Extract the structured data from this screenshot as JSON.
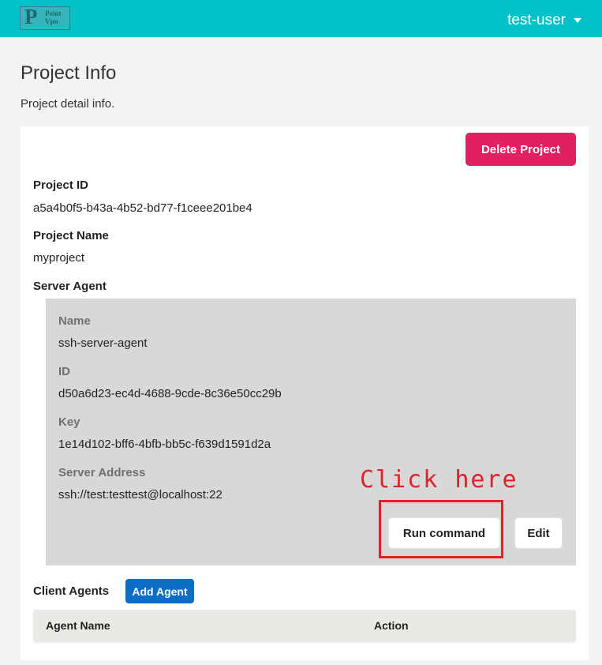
{
  "header": {
    "logo_letter": "P",
    "logo_text_line1": "Point",
    "logo_text_line2": "Vpn",
    "user_menu_label": "test-user"
  },
  "page": {
    "title": "Project Info",
    "subtitle": "Project detail info."
  },
  "actions": {
    "delete_project_label": "Delete Project"
  },
  "project": {
    "id_label": "Project ID",
    "id_value": "a5a4b0f5-b43a-4b52-bd77-f1ceee201be4",
    "name_label": "Project Name",
    "name_value": "myproject"
  },
  "server_agent": {
    "section_label": "Server Agent",
    "name_label": "Name",
    "name_value": "ssh-server-agent",
    "id_label": "ID",
    "id_value": "d50a6d23-ec4d-4688-9cde-8c36e50cc29b",
    "key_label": "Key",
    "key_value": "1e14d102-bff6-4bfb-bb5c-f639d1591d2a",
    "address_label": "Server Address",
    "address_value": "ssh://test:testtest@localhost:22",
    "run_command_label": "Run command",
    "edit_label": "Edit"
  },
  "annotation": {
    "text": "Click here",
    "color": "#e0202a"
  },
  "client_agents": {
    "section_label": "Client Agents",
    "add_agent_label": "Add Agent",
    "columns": [
      "Agent Name",
      "Action"
    ],
    "rows": []
  },
  "colors": {
    "header_bg": "#00c0c8",
    "delete_button": "#e0205f",
    "add_agent_button": "#0a6ec4",
    "agent_box_bg": "#d8d8d8"
  }
}
